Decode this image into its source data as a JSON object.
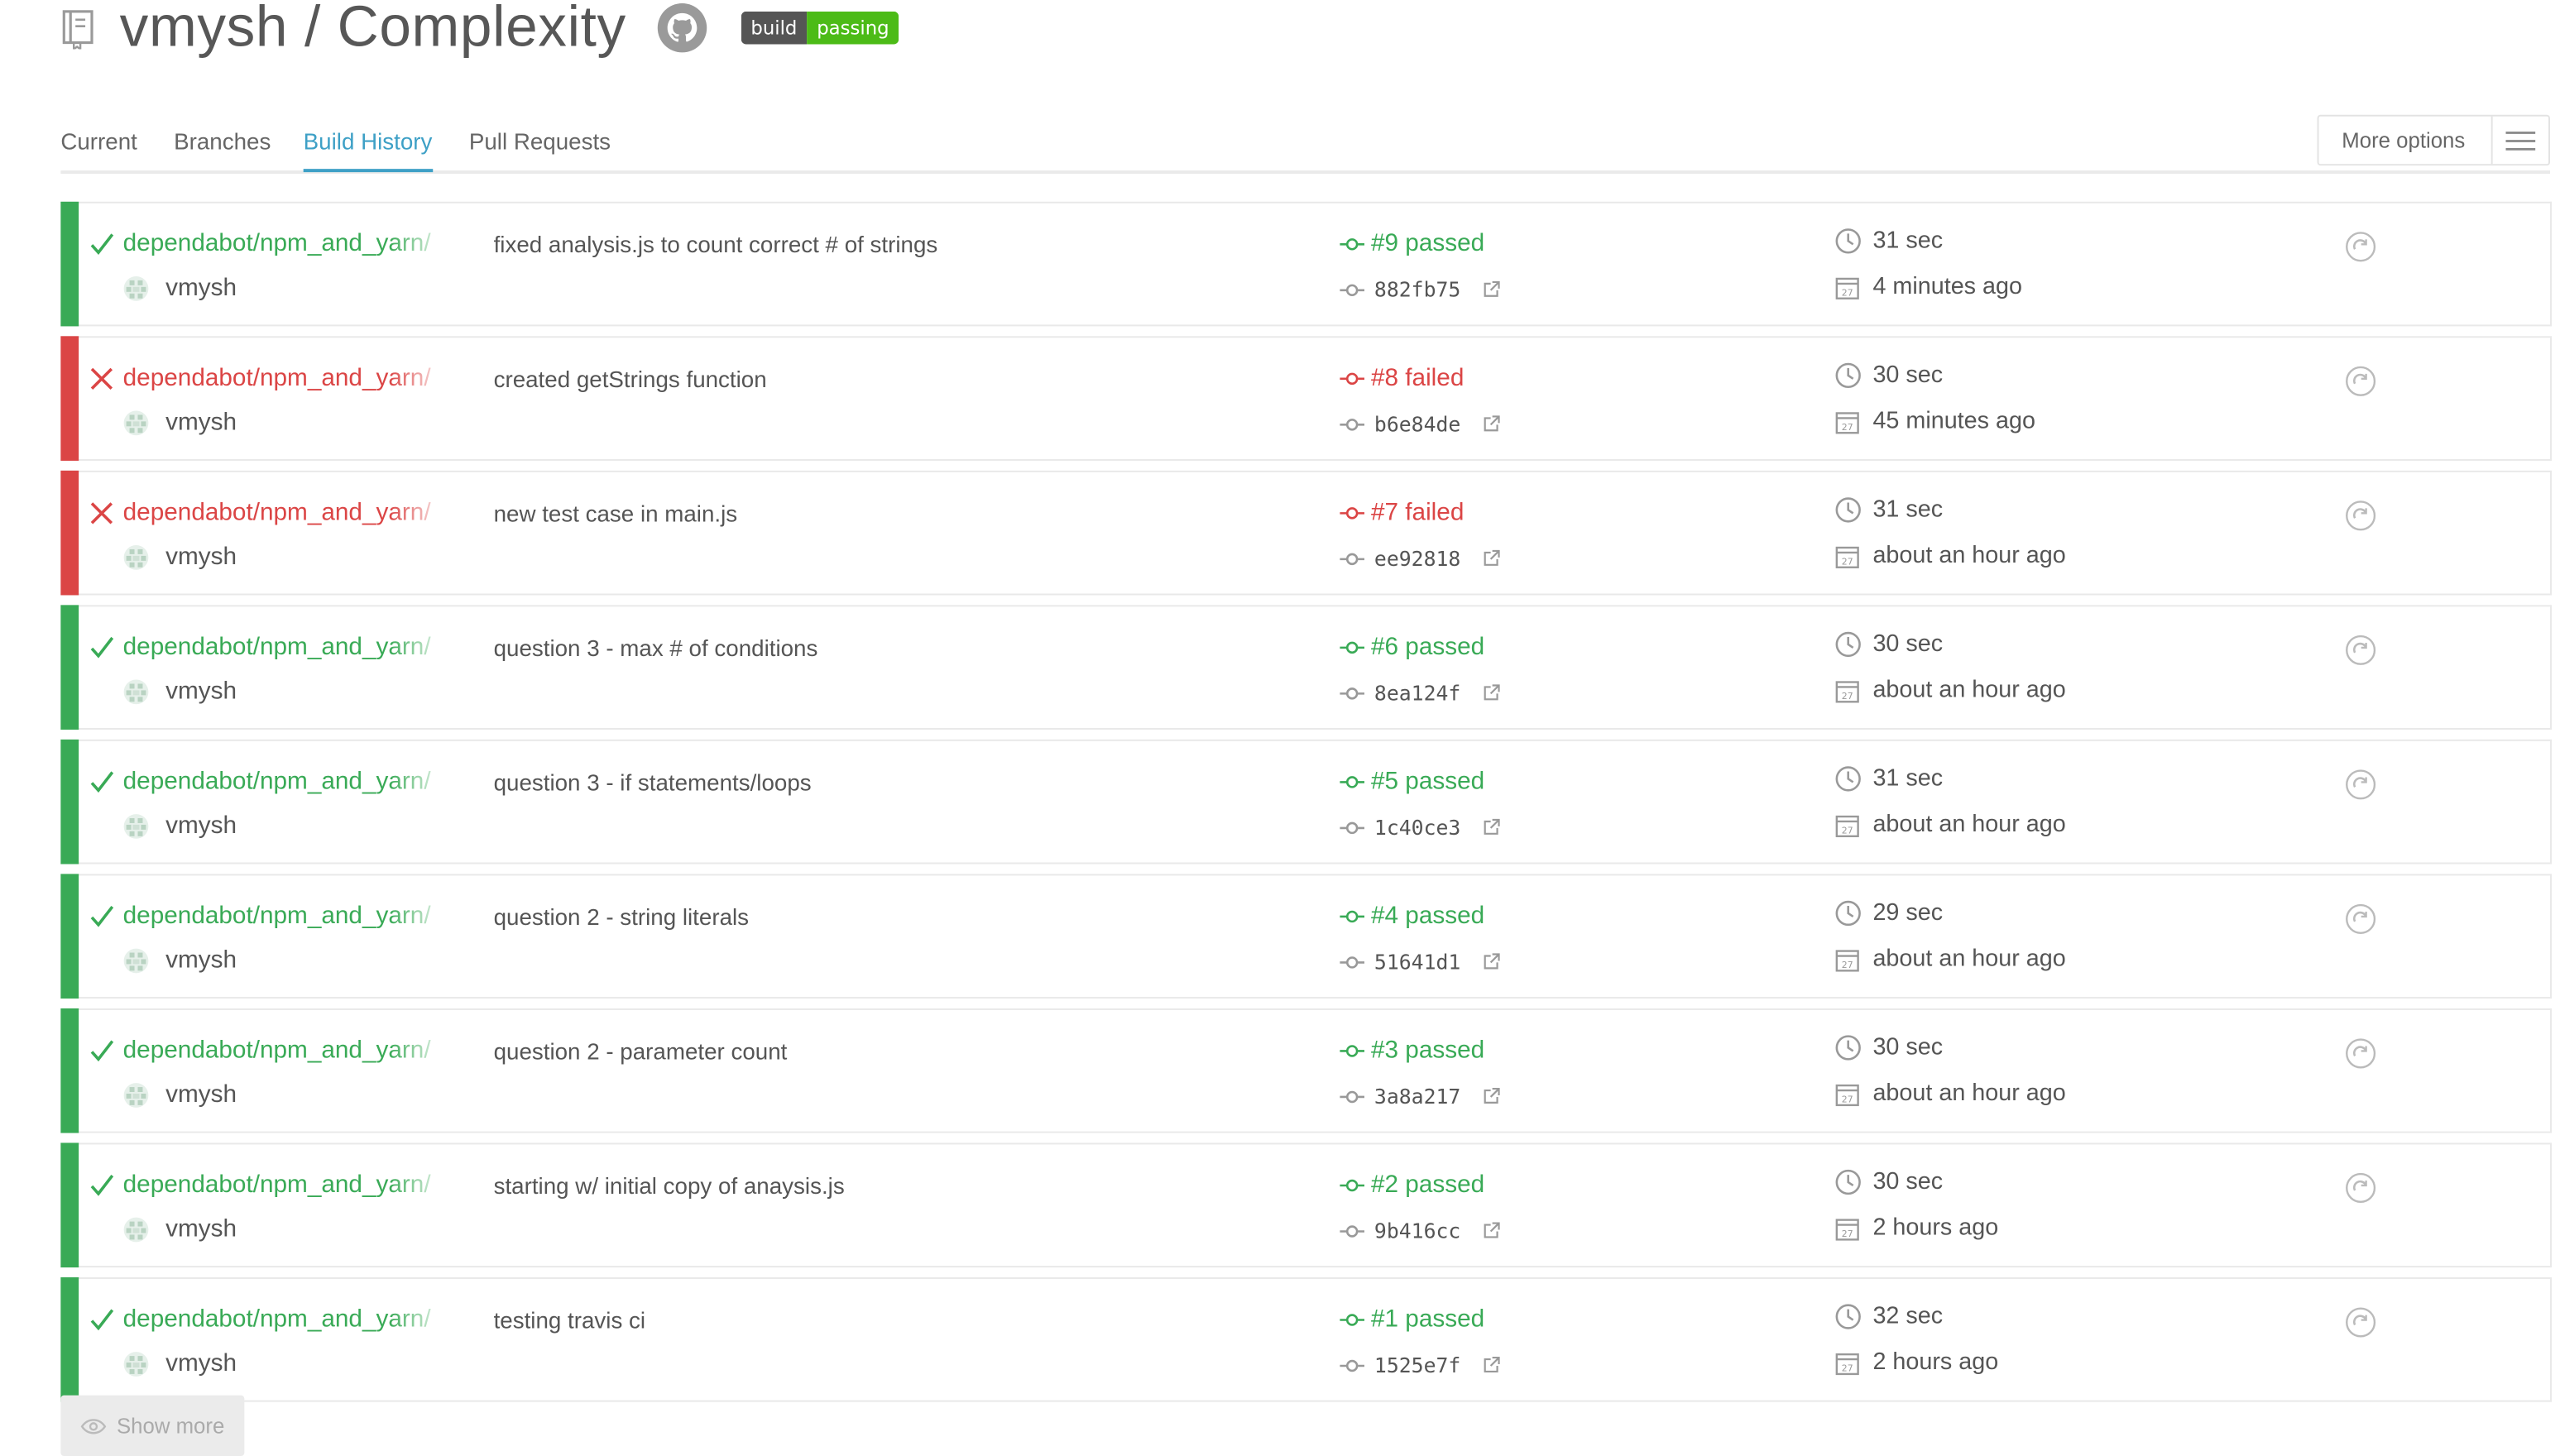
{
  "header": {
    "repo_title": "vmysh / Complexity",
    "badge_left": "build",
    "badge_right": "passing"
  },
  "tabs": [
    "Current",
    "Branches",
    "Build History",
    "Pull Requests"
  ],
  "active_tab": "Build History",
  "more_options_label": "More options",
  "builds": [
    {
      "state": "passed",
      "branch": "dependabot/npm_and_yarn/",
      "author": "vmysh",
      "message": "fixed analysis.js to count correct # of strings",
      "build": "#9 passed",
      "sha": "882fb75",
      "duration": "31 sec",
      "finished": "4 minutes ago"
    },
    {
      "state": "failed",
      "branch": "dependabot/npm_and_yarn/",
      "author": "vmysh",
      "message": "created getStrings function",
      "build": "#8 failed",
      "sha": "b6e84de",
      "duration": "30 sec",
      "finished": "45 minutes ago"
    },
    {
      "state": "failed",
      "branch": "dependabot/npm_and_yarn/",
      "author": "vmysh",
      "message": "new test case in main.js",
      "build": "#7 failed",
      "sha": "ee92818",
      "duration": "31 sec",
      "finished": "about an hour ago"
    },
    {
      "state": "passed",
      "branch": "dependabot/npm_and_yarn/",
      "author": "vmysh",
      "message": "question 3 - max # of conditions",
      "build": "#6 passed",
      "sha": "8ea124f",
      "duration": "30 sec",
      "finished": "about an hour ago"
    },
    {
      "state": "passed",
      "branch": "dependabot/npm_and_yarn/",
      "author": "vmysh",
      "message": "question 3 - if statements/loops",
      "build": "#5 passed",
      "sha": "1c40ce3",
      "duration": "31 sec",
      "finished": "about an hour ago"
    },
    {
      "state": "passed",
      "branch": "dependabot/npm_and_yarn/",
      "author": "vmysh",
      "message": "question 2 - string literals",
      "build": "#4 passed",
      "sha": "51641d1",
      "duration": "29 sec",
      "finished": "about an hour ago"
    },
    {
      "state": "passed",
      "branch": "dependabot/npm_and_yarn/",
      "author": "vmysh",
      "message": "question 2 - parameter count",
      "build": "#3 passed",
      "sha": "3a8a217",
      "duration": "30 sec",
      "finished": "about an hour ago"
    },
    {
      "state": "passed",
      "branch": "dependabot/npm_and_yarn/",
      "author": "vmysh",
      "message": "starting w/ initial copy of anaysis.js",
      "build": "#2 passed",
      "sha": "9b416cc",
      "duration": "30 sec",
      "finished": "2 hours ago"
    },
    {
      "state": "passed",
      "branch": "dependabot/npm_and_yarn/",
      "author": "vmysh",
      "message": "testing travis ci",
      "build": "#1 passed",
      "sha": "1525e7f",
      "duration": "32 sec",
      "finished": "2 hours ago"
    }
  ],
  "show_more_label": "Show more",
  "colors": {
    "passed": "#39aa56",
    "failed": "#db4545",
    "accent": "#3ea0c6"
  }
}
